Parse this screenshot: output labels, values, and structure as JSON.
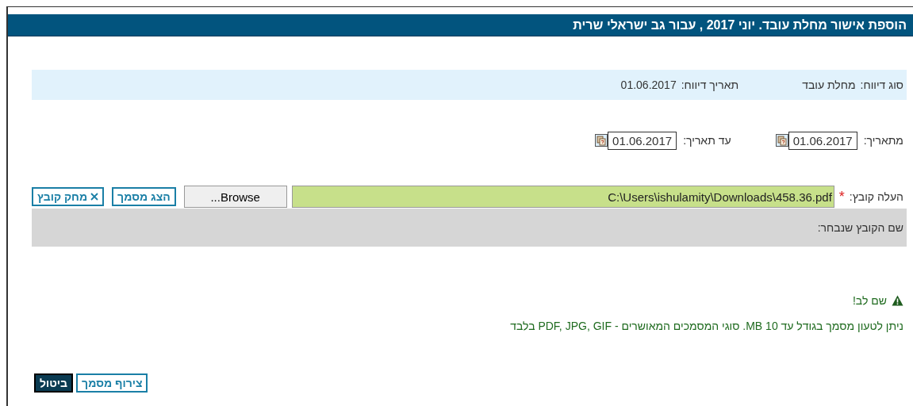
{
  "window": {
    "title": "הוספת אישור מחלת עובד. יוני 2017 , עבור גב ישראלי שרית"
  },
  "report_info": [
    {
      "label": "סוג דיווח:",
      "value": "מחלת עובד"
    },
    {
      "label": "תאריך דיווח:",
      "value": "01.06.2017"
    }
  ],
  "date_range": [
    {
      "label": "מתאריך:",
      "value": "01.06.2017"
    },
    {
      "label": "עד תאריך:",
      "value": "01.06.2017"
    }
  ],
  "upload": {
    "label": "העלה קובץ:",
    "required_mark": "*",
    "value": "C:\\Users\\ishulamity\\Downloads\\458.36.pdf",
    "browse": "Browse...",
    "show_button": "הצג מסמך",
    "delete_button": "מחק קובץ"
  },
  "selected_file": {
    "label": "שם הקובץ שנבחר:"
  },
  "notice": {
    "title": "שם לב!",
    "text": "ניתן לטעון מסמך בגודל עד 10 MB.  סוגי המסמכים המאושרים - PDF, JPG, GIF בלבד"
  },
  "actions": [
    {
      "label": "צירוף מסמך",
      "kind": "outline"
    },
    {
      "label": "ביטול",
      "kind": "filled"
    }
  ]
}
